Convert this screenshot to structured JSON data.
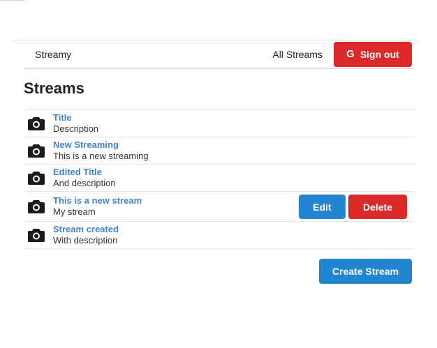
{
  "header": {
    "brand": "Streamy",
    "all_streams_label": "All Streams",
    "sign_out_label": "Sign out",
    "google_glyph": "G"
  },
  "page": {
    "heading": "Streams"
  },
  "streams": [
    {
      "title": "Title",
      "description": "Description",
      "icon": "camera-icon"
    },
    {
      "title": "New Streaming",
      "description": "This is a new streaming",
      "icon": "camera-icon"
    },
    {
      "title": "Edited Title",
      "description": "And description",
      "icon": "camera-icon"
    },
    {
      "title": "This is a new stream",
      "description": "My stream",
      "icon": "camera-icon"
    },
    {
      "title": "Stream created",
      "description": "With description",
      "icon": "camera-icon"
    }
  ],
  "actions": {
    "edit_label": "Edit",
    "delete_label": "Delete",
    "create_label": "Create Stream"
  },
  "colors": {
    "primary_blue": "#2185d0",
    "danger_red": "#db2828",
    "link_blue": "#4183c4"
  }
}
